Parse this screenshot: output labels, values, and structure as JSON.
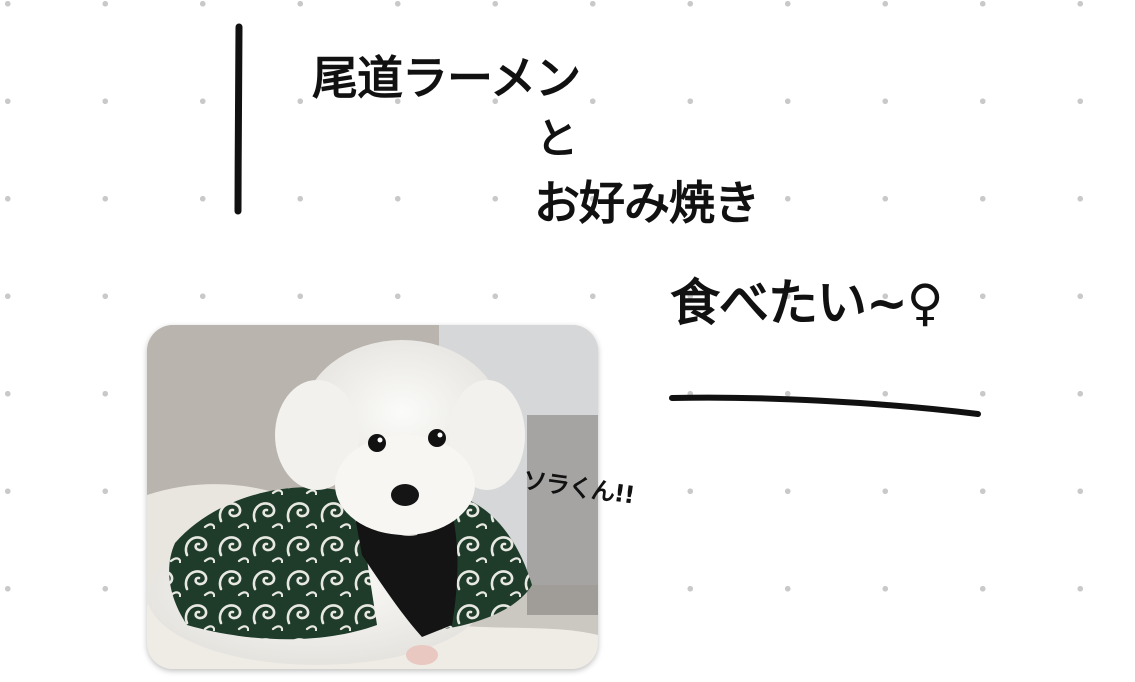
{
  "note": {
    "line1": "尾道ラーメン",
    "line2": "と",
    "line3": "お好み焼き",
    "line4": "食べたい~♀"
  },
  "photo": {
    "caption": "ソラくん!!"
  },
  "colors": {
    "background": "#ffffff",
    "dot_grid": "#c9c9c9",
    "ink": "#111111",
    "wall": "#cbc7c1",
    "outfit": "#1f3b2a"
  }
}
